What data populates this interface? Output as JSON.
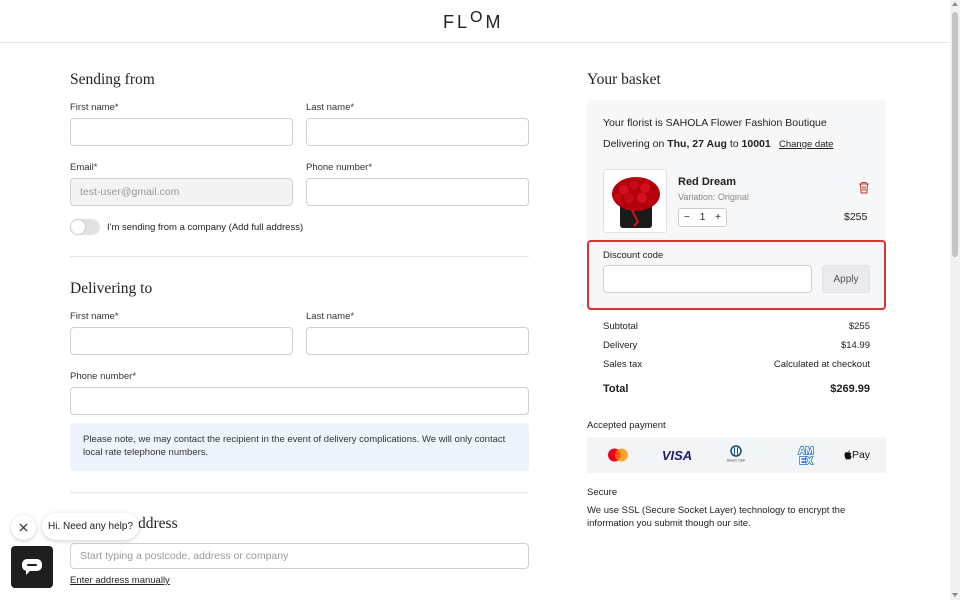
{
  "header": {
    "logo_prefix": "FL",
    "logo_raised": "O",
    "logo_suffix": "M"
  },
  "sending_from": {
    "title": "Sending from",
    "first_name_label": "First name*",
    "last_name_label": "Last name*",
    "email_label": "Email*",
    "email_value": "test-user@gmail.com",
    "phone_label": "Phone number*",
    "company_toggle_label": "I'm sending from a company (Add full address)"
  },
  "delivering_to": {
    "title": "Delivering to",
    "first_name_label": "First name*",
    "last_name_label": "Last name*",
    "phone_label": "Phone number*",
    "notice": "Please note, we may contact the recipient in the event of delivery complications. We will only contact local rate telephone numbers."
  },
  "address": {
    "title_visible": "ddress",
    "placeholder": "Start typing a postcode, address or company",
    "manual_link": "Enter address manually"
  },
  "chat": {
    "greeting": "Hi. Need any help?"
  },
  "basket": {
    "title": "Your basket",
    "florist_prefix": "Your florist is",
    "florist_name": "SAHOLA Flower Fashion Boutique",
    "delivering_prefix": "Delivering on",
    "delivery_date": "Thu, 27 Aug",
    "to_text": "to",
    "zip": "10001",
    "change_date": "Change date",
    "product": {
      "name": "Red Dream",
      "variation": "Variation: Original",
      "quantity": "1",
      "price": "$255"
    },
    "discount_label": "Discount code",
    "apply_label": "Apply",
    "summary": [
      {
        "label": "Subtotal",
        "value": "$255"
      },
      {
        "label": "Delivery",
        "value": "$14.99"
      },
      {
        "label": "Sales tax",
        "value": "Calculated at checkout"
      }
    ],
    "total_label": "Total",
    "total_value": "$269.99"
  },
  "payment": {
    "title": "Accepted payment",
    "visa": "VISA",
    "amex_top": "AM",
    "amex_bottom": "EX",
    "applepay": "Pay",
    "diners": "Diners Club"
  },
  "secure": {
    "title": "Secure",
    "text": "We use SSL (Secure Socket Layer) technology to encrypt the information you submit though our site."
  },
  "colors": {
    "highlight": "#e03131",
    "notice_bg": "#eef4fb",
    "panel_bg": "#f6f7f9"
  }
}
